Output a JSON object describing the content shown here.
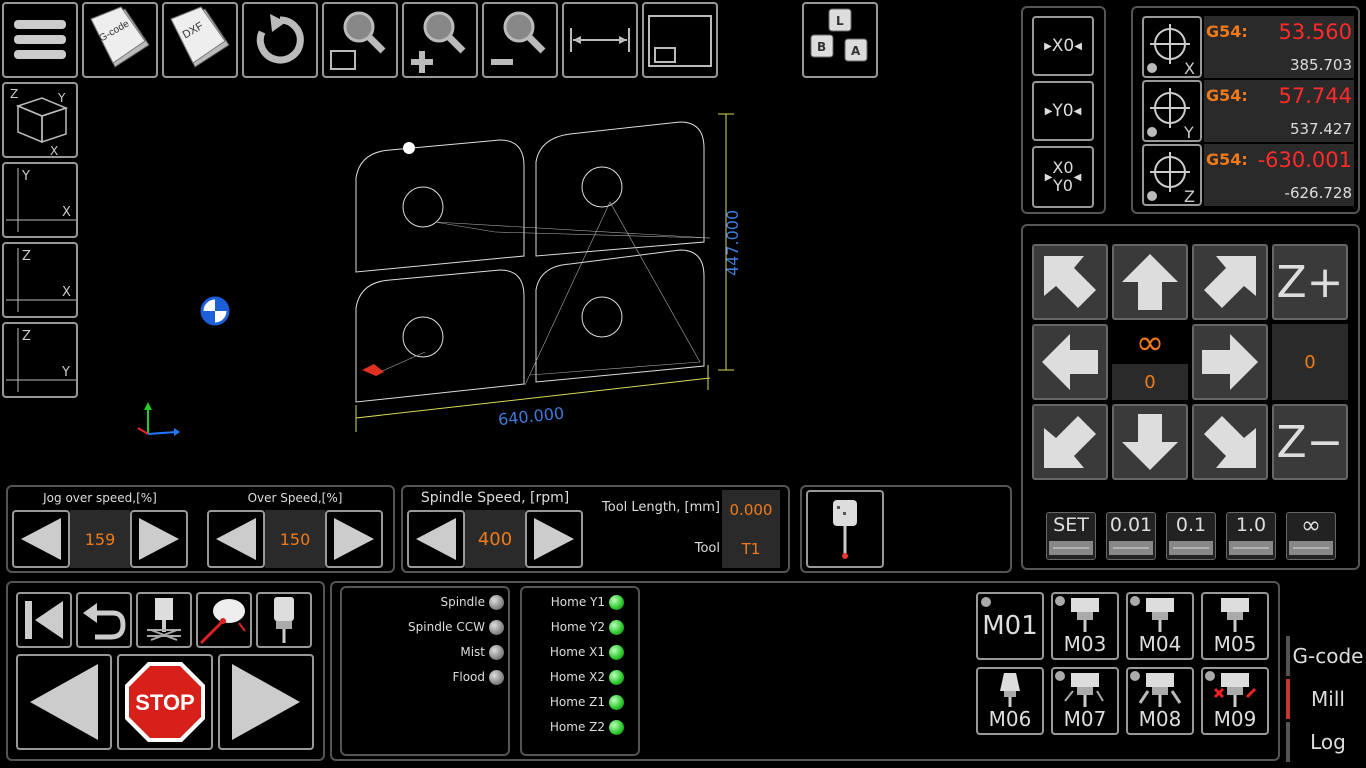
{
  "toolbar": {
    "gcode_file_label": "G-code",
    "dxf_file_label": "DXF",
    "abc_keys": [
      "L",
      "B",
      "A"
    ]
  },
  "view": {
    "cube_axes": {
      "z": "Z",
      "y": "Y",
      "x": "X"
    },
    "xy": {
      "a": "Y",
      "b": "X"
    },
    "xz": {
      "a": "Z",
      "b": "X"
    },
    "yz": {
      "a": "Z",
      "b": "Y"
    }
  },
  "drawing": {
    "dim_width": "640.000",
    "dim_height": "447.000"
  },
  "zero_buttons": {
    "x": "X0",
    "y": "Y0",
    "xy_top": "X0",
    "xy_bottom": "Y0"
  },
  "dro": [
    {
      "axis": "X",
      "wcs": "G54:",
      "work": "53.560",
      "machine": "385.703"
    },
    {
      "axis": "Y",
      "wcs": "G54:",
      "work": "57.744",
      "machine": "537.427"
    },
    {
      "axis": "Z",
      "wcs": "G54:",
      "work": "-630.001",
      "machine": "-626.728"
    }
  ],
  "jog": {
    "z_plus": "Z+",
    "z_minus": "Z−",
    "infinity": "∞",
    "step_value": "0",
    "z_value": "0",
    "steps": [
      "SET",
      "0.01",
      "0.1",
      "1.0",
      "∞"
    ]
  },
  "overrides": {
    "jog_label": "Jog over speed,[%]",
    "jog_value": "159",
    "feed_label": "Over Speed,[%]",
    "feed_value": "150",
    "spindle_label": "Spindle Speed, [rpm]",
    "spindle_value": "400",
    "tool_length_label": "Tool Length, [mm]",
    "tool_length_value": "0.000",
    "tool_label": "Tool",
    "tool_value": "T1"
  },
  "program": {
    "stop_label": "STOP"
  },
  "outputs": [
    {
      "label": "Spindle",
      "state": "off"
    },
    {
      "label": "Spindle CCW",
      "state": "off"
    },
    {
      "label": "Mist",
      "state": "off"
    },
    {
      "label": "Flood",
      "state": "off"
    }
  ],
  "homes": [
    {
      "label": "Home Y1",
      "state": "on"
    },
    {
      "label": "Home Y2",
      "state": "on"
    },
    {
      "label": "Home X1",
      "state": "on"
    },
    {
      "label": "Home X2",
      "state": "on"
    },
    {
      "label": "Home Z1",
      "state": "on"
    },
    {
      "label": "Home Z2",
      "state": "on"
    }
  ],
  "mcodes": [
    "M01",
    "M03",
    "M04",
    "M05",
    "M06",
    "M07",
    "M08",
    "M09"
  ],
  "tabs": [
    "G-code",
    "Mill",
    "Log"
  ],
  "colors": {
    "accent_orange": "#f07a1a",
    "dro_red": "#ff2a2a",
    "dim_blue": "#3d7ad9",
    "dim_yellow": "#d8d85a",
    "active_tab": "#c0392b"
  }
}
